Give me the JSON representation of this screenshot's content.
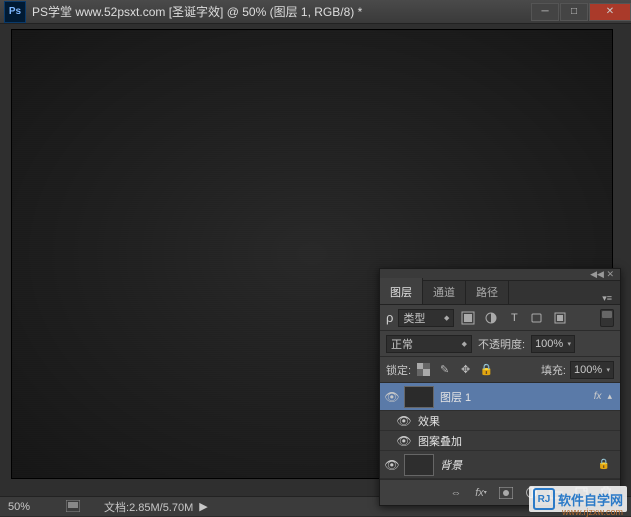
{
  "titlebar": {
    "logo_text": "Ps",
    "title": "PS学堂 www.52psxt.com [圣诞字效] @ 50% (图层 1, RGB/8) *"
  },
  "statusbar": {
    "zoom": "50%",
    "doc_label": "文档:",
    "doc_size": "2.85M/5.70M"
  },
  "panel": {
    "tabs": {
      "layers": "图层",
      "channels": "通道",
      "paths": "路径"
    },
    "filter": {
      "kind": "类型"
    },
    "blend": {
      "mode": "正常",
      "opacity_label": "不透明度:",
      "opacity_value": "100%"
    },
    "lock": {
      "label": "锁定:",
      "fill_label": "填充:",
      "fill_value": "100%"
    },
    "layers": {
      "layer1": {
        "name": "图层 1",
        "fx": "fx"
      },
      "effects_label": "效果",
      "pattern_overlay": "图案叠加",
      "background": {
        "name": "背景"
      }
    }
  },
  "watermark": {
    "logo": "RJ",
    "text": "软件自学网",
    "url": "www.rjzxw.com"
  }
}
